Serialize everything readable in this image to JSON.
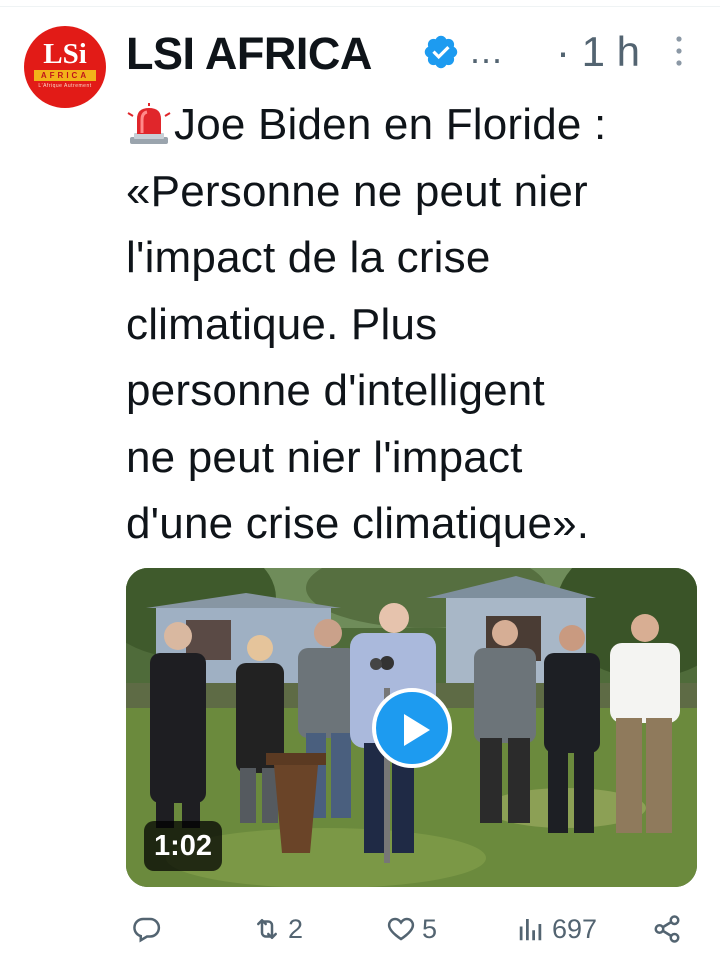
{
  "author": {
    "name": "LSI AFRICA",
    "avatar": {
      "logo_text": "LSi",
      "band_text": "AFRICA",
      "tagline": "L'Afrique Autrement",
      "background": "#e21b17"
    },
    "verified": true,
    "ellipsis": "...",
    "timestamp": "· 1 h"
  },
  "tweet": {
    "emoji": "rotating-light-icon",
    "lines": [
      "Joe Biden en Floride :",
      "«Personne ne peut nier",
      "l'impact de la crise",
      "climatique. Plus",
      "personne d'intelligent",
      "ne peut nier l'impact",
      "d'une crise climatique»."
    ]
  },
  "media": {
    "type": "video",
    "duration": "1:02"
  },
  "actions": {
    "reply_count": "",
    "retweet_count": "2",
    "like_count": "5",
    "views_count": "697"
  },
  "colors": {
    "accent": "#1d9bf0",
    "text": "#0f1419",
    "secondary": "#536471"
  }
}
